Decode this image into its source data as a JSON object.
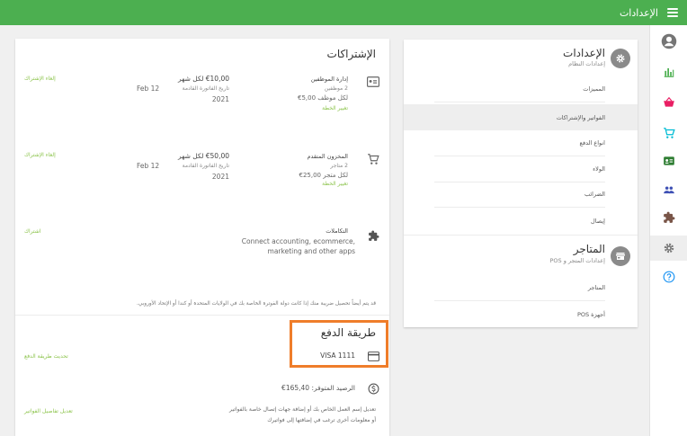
{
  "topbar": {
    "title": "الإعدادات",
    "color": "#4caf50"
  },
  "rail": {
    "items": [
      {
        "name": "account-icon",
        "color": "#757575"
      },
      {
        "name": "bar-chart-icon",
        "color": "#4caf50"
      },
      {
        "name": "basket-icon",
        "color": "#e91e63"
      },
      {
        "name": "cart-icon",
        "color": "#00bcd4"
      },
      {
        "name": "id-card-icon",
        "color": "#2e7d32"
      },
      {
        "name": "people-icon",
        "color": "#3f51b5"
      },
      {
        "name": "puzzle-icon",
        "color": "#795548"
      },
      {
        "name": "gear-icon",
        "color": "#757575"
      },
      {
        "name": "help-icon",
        "color": "#2196f3"
      }
    ]
  },
  "nav": {
    "settings": {
      "title": "الإعدادات",
      "subtitle": "إعدادات النظام",
      "items": [
        {
          "label": "المميزات"
        },
        {
          "label": "الفواتير والإشتراكات"
        },
        {
          "label": "انواع الدفع"
        },
        {
          "label": "الولاء"
        },
        {
          "label": "الضرائب"
        },
        {
          "label": "إيصال"
        }
      ]
    },
    "stores": {
      "title": "المتاجر",
      "subtitle": "إعدادات المتجر و POS",
      "items": [
        {
          "label": "المتاجر"
        },
        {
          "label": "أجهزة POS"
        }
      ]
    }
  },
  "subscriptions": {
    "title": "الإشتراكات",
    "items": [
      {
        "name": "إدارة الموظفين",
        "detail1": "2 موظفين",
        "detail2": "€5,00 لكل موظف",
        "change_label": "تغيير الخطة",
        "price": "€10,00 لكل شهر",
        "next_invoice_label": "تاريخ الفاتورة القادمة",
        "next_invoice_date": "Feb 12",
        "next_invoice_year": "2021",
        "cancel_label": "إلغاء الإشتراك"
      },
      {
        "name": "المخزون المتقدم",
        "detail1": "2 متاجر",
        "detail2": "€25,00 لكل متجر",
        "change_label": "تغيير الخطة",
        "price": "€50,00 لكل شهر",
        "next_invoice_label": "تاريخ الفاتورة القادمة",
        "next_invoice_date": "Feb 12",
        "next_invoice_year": "2021",
        "cancel_label": "إلغاء الإشتراك"
      }
    ],
    "integrations": {
      "name": "التكاملات",
      "description_line1": "Connect accounting, ecommerce,",
      "description_line2": "marketing and other apps",
      "action_label": "اشتراك"
    },
    "vat_note": "قد يتم أيضاً تحصيل ضريبة منك إذا كانت دولة الفوترة الخاصة بك في الولايات المتحدة أو كندا أو الإتحاد الأوروبي."
  },
  "payment": {
    "title": "طريقة الدفع",
    "card": "VISA 1111",
    "update_label": "تحديث طريقة الدفع",
    "balance": "الرصيد المتوفر: 165,40€",
    "billing_note_line1": "تعديل إسم العمل الخاص بك أو إضافة جهات إتصال خاصة بالفواتير",
    "billing_note_line2": "أو معلومات أخرى ترغب في إضافتها إلى فواتيرك",
    "billing_edit_label": "تعديل تفاصيل الفواتير"
  },
  "colors": {
    "accent_green": "#8bc34a",
    "highlight_orange": "#ef7d2a"
  }
}
